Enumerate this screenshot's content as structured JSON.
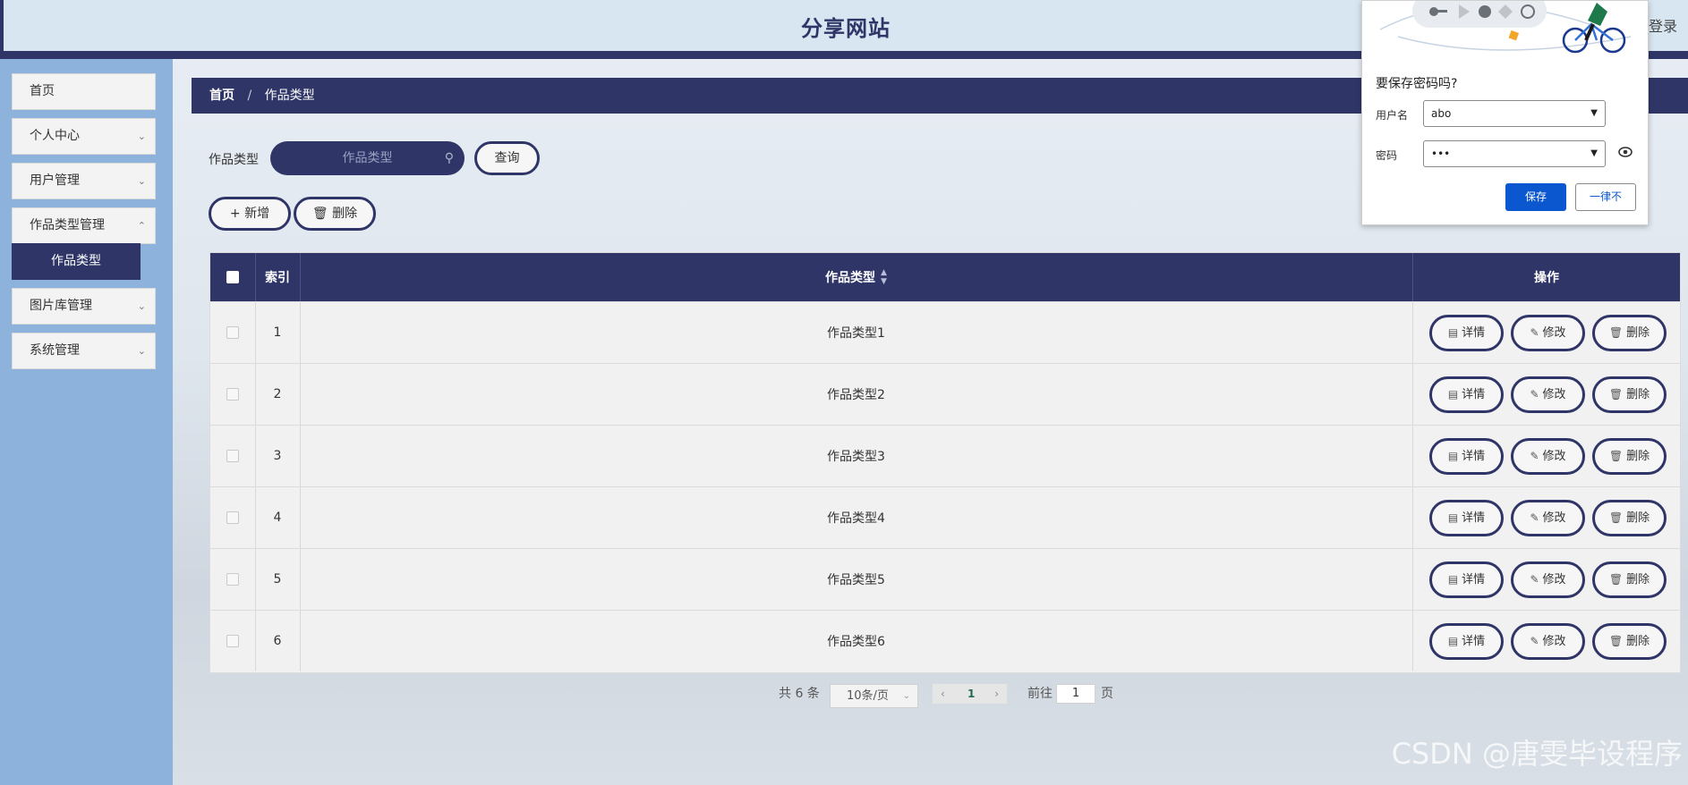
{
  "header": {
    "title": "分享网站",
    "login": "登录"
  },
  "sidebar": {
    "items": [
      {
        "label": "首页"
      },
      {
        "label": "个人中心"
      },
      {
        "label": "用户管理"
      },
      {
        "label": "作品类型管理"
      },
      {
        "label": "图片库管理"
      },
      {
        "label": "系统管理"
      }
    ],
    "active_sub": "作品类型"
  },
  "breadcrumb": {
    "home": "首页",
    "separator": "/",
    "current": "作品类型"
  },
  "search": {
    "label": "作品类型",
    "placeholder": "作品类型",
    "query_button": "查询"
  },
  "toolbar": {
    "add": "新增",
    "delete": "删除"
  },
  "table": {
    "headers": {
      "index": "索引",
      "type": "作品类型",
      "actions": "操作"
    },
    "rows": [
      {
        "index": "1",
        "type": "作品类型1"
      },
      {
        "index": "2",
        "type": "作品类型2"
      },
      {
        "index": "3",
        "type": "作品类型3"
      },
      {
        "index": "4",
        "type": "作品类型4"
      },
      {
        "index": "5",
        "type": "作品类型5"
      },
      {
        "index": "6",
        "type": "作品类型6"
      }
    ],
    "actions": {
      "detail": "详情",
      "edit": "修改",
      "delete": "删除"
    }
  },
  "pagination": {
    "total": "共 6 条",
    "page_size": "10条/页",
    "current_page": "1",
    "goto_label": "前往",
    "goto_value": "1",
    "page_suffix": "页"
  },
  "password_popup": {
    "question": "要保存密码吗?",
    "username_label": "用户名",
    "username_value": "abo",
    "password_label": "密码",
    "password_value": "•••",
    "save": "保存",
    "never": "一律不"
  },
  "watermark": "CSDN @唐雯毕设程序",
  "colors": {
    "primary": "#2f3567",
    "sidebar": "#8db3dc",
    "header": "#d7e6f1",
    "chrome_blue": "#0b57d0"
  }
}
